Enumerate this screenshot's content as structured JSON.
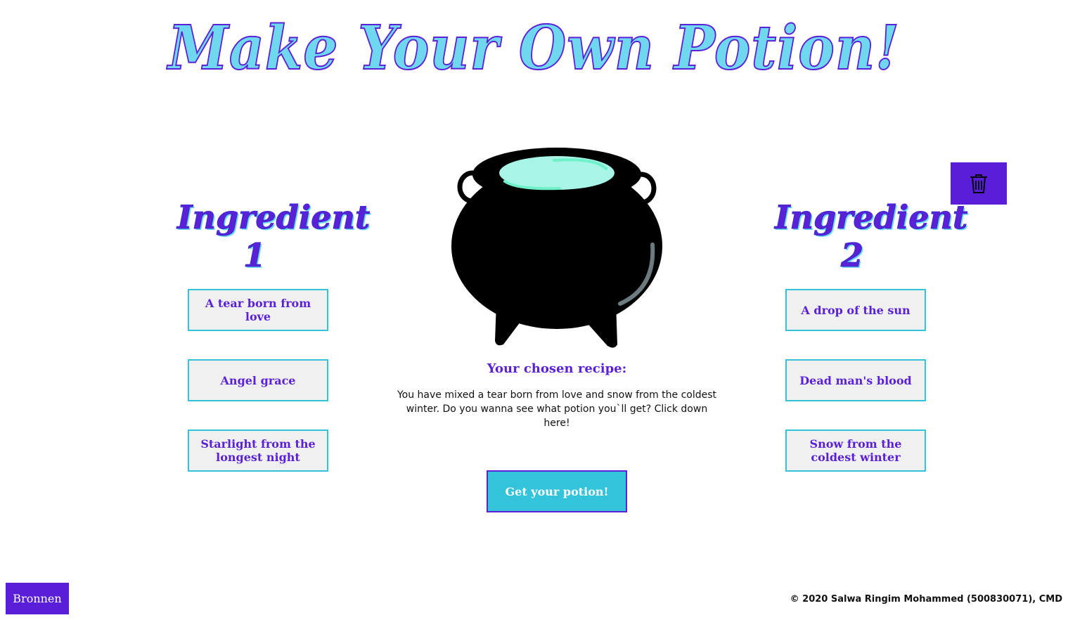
{
  "header": {
    "title": "Make Your Own Potion!"
  },
  "ingredients_left": {
    "heading": "Ingredient 1",
    "items": [
      {
        "label": "A tear born from love"
      },
      {
        "label": "Angel grace"
      },
      {
        "label": "Starlight from the longest night"
      }
    ]
  },
  "ingredients_right": {
    "heading": "Ingredient 2",
    "items": [
      {
        "label": "A drop of the sun"
      },
      {
        "label": "Dead man's blood"
      },
      {
        "label": "Snow from the coldest winter"
      }
    ]
  },
  "recipe": {
    "title": "Your chosen recipe:",
    "text": "You have mixed a tear born from love and snow from the coldest winter. Do you wanna see what potion you`ll get? Click down here!"
  },
  "actions": {
    "get_potion_label": "Get your potion!",
    "trash_icon": "trash-icon",
    "bronnen_label": "Bronnen"
  },
  "footer": {
    "copyright": "© 2020 Salwa Ringim Mohammed (500830071), CMD"
  },
  "colors": {
    "purple": "#5a21d6",
    "cyan": "#33c4dc",
    "potion": "#a8f5e8"
  }
}
